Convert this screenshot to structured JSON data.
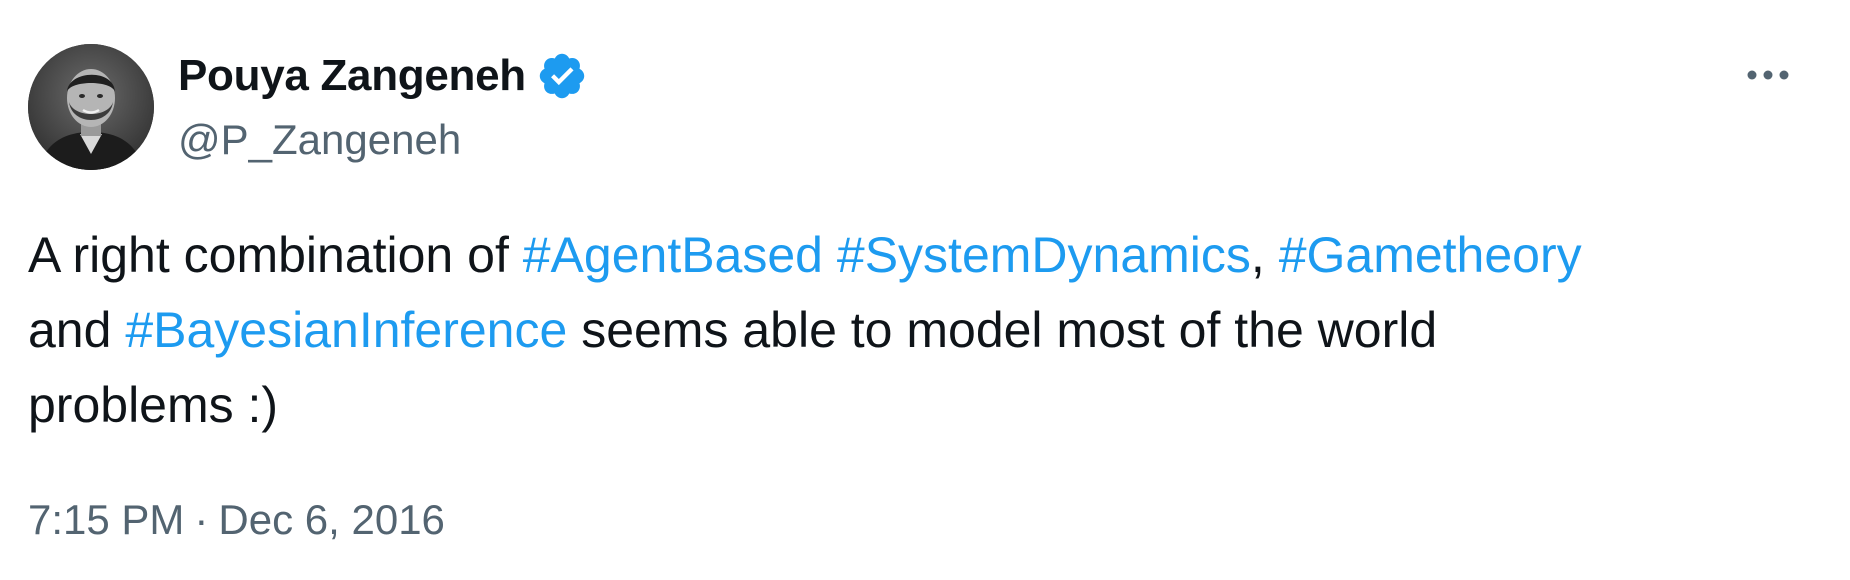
{
  "author": {
    "display_name": "Pouya Zangeneh",
    "handle": "@P_Zangeneh",
    "verified_icon": "verified-badge-icon",
    "avatar_desc": "avatar"
  },
  "tweet": {
    "text_a": "A right combination of ",
    "hashtag_1": "#AgentBased",
    "text_b": " ",
    "hashtag_2": "#SystemDynamics",
    "text_c": ", ",
    "hashtag_3": "#Gametheory",
    "text_d": "and ",
    "hashtag_4": "#BayesianInference",
    "text_e": " seems able to model most of the world",
    "text_f": "problems :)"
  },
  "meta": {
    "time": "7:15 PM",
    "separator": "·",
    "date": "Dec 6, 2016"
  },
  "colors": {
    "link": "#1d9bf0",
    "secondary": "#536471",
    "primary": "#0f1419"
  },
  "icons": {
    "more": "more-horizontal-icon"
  }
}
